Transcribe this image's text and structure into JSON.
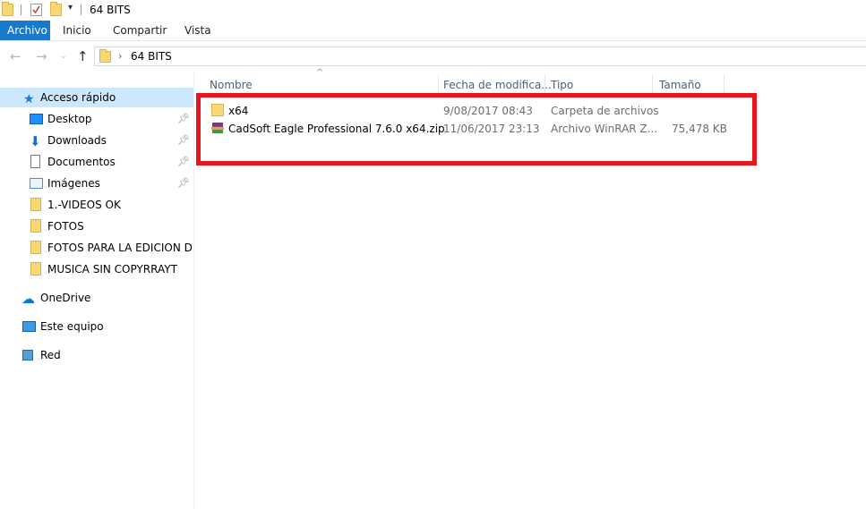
{
  "window": {
    "title": "64 BITS"
  },
  "ribbon": {
    "tabs": [
      "Archivo",
      "Inicio",
      "Compartir",
      "Vista"
    ]
  },
  "address_bar": {
    "path": [
      "64 BITS"
    ],
    "separator": "›"
  },
  "nav_pane": {
    "items": [
      {
        "label": "Acceso rápido",
        "icon": "star-icon",
        "selected": true
      },
      {
        "label": "Desktop",
        "icon": "desktop-icon",
        "pinned": true
      },
      {
        "label": "Downloads",
        "icon": "download-icon",
        "pinned": true
      },
      {
        "label": "Documentos",
        "icon": "document-icon",
        "pinned": true
      },
      {
        "label": "Imágenes",
        "icon": "pictures-icon",
        "pinned": true
      },
      {
        "label": "1.-VIDEOS OK",
        "icon": "folder-icon"
      },
      {
        "label": "FOTOS",
        "icon": "folder-icon"
      },
      {
        "label": "FOTOS PARA LA EDICION DE V",
        "icon": "folder-icon"
      },
      {
        "label": "MUSICA SIN COPYRRAYT",
        "icon": "folder-icon"
      },
      {
        "label": "OneDrive",
        "icon": "cloud-icon"
      },
      {
        "label": "Este equipo",
        "icon": "computer-icon"
      },
      {
        "label": "Red",
        "icon": "network-icon"
      }
    ]
  },
  "file_list": {
    "columns": [
      "Nombre",
      "Fecha de modifica...",
      "Tipo",
      "Tamaño"
    ],
    "rows": [
      {
        "name": "x64",
        "date": "9/08/2017 08:43",
        "type": "Carpeta de archivos",
        "size": "",
        "icon": "folder-icon"
      },
      {
        "name": "CadSoft Eagle Professional 7.6.0 x64.zip",
        "date": "11/06/2017 23:13",
        "type": "Archivo WinRAR Z...",
        "size": "75,478 KB",
        "icon": "winrar-archive-icon"
      }
    ]
  },
  "annotation": {
    "highlight_color": "#e8161e"
  },
  "colors": {
    "accent": "#1979ca",
    "selected_bg": "#cce8ff",
    "folder": "#f8d775"
  }
}
